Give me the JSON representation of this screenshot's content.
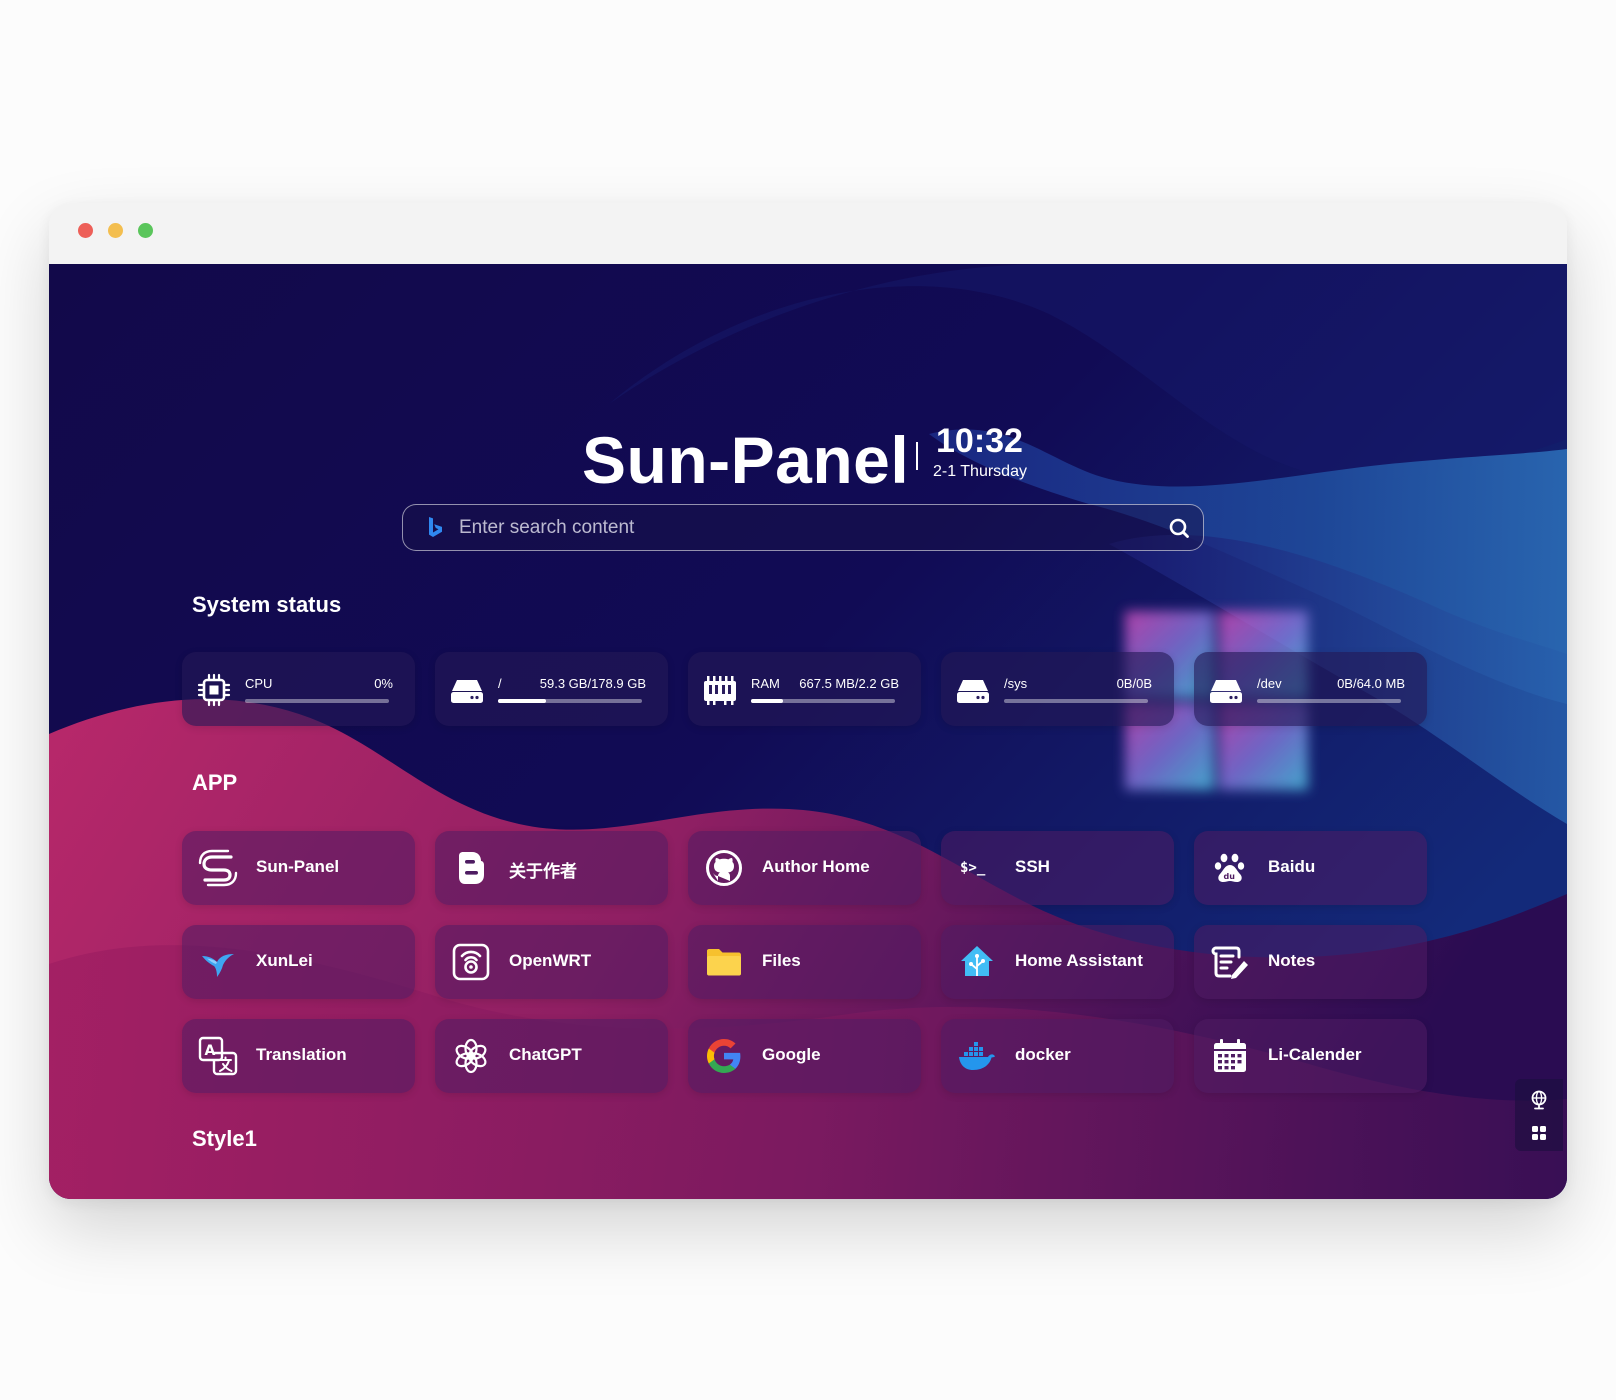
{
  "window": {
    "controls": [
      "close",
      "minimize",
      "maximize"
    ],
    "colors": {
      "close": "#ed5f58",
      "minimize": "#f3be4f",
      "maximize": "#5ac55b"
    }
  },
  "header": {
    "brand": "Sun-Panel",
    "time": "10:32",
    "date": "2-1 Thursday"
  },
  "search": {
    "placeholder": "Enter search content",
    "engine_icon": "bing-icon",
    "button_icon": "search-icon"
  },
  "system_status": {
    "title": "System status",
    "cards": [
      {
        "icon": "cpu-icon",
        "label": "CPU",
        "value": "0%",
        "usage": 0
      },
      {
        "icon": "drive-icon",
        "label": "/",
        "value": "59.3 GB/178.9 GB",
        "usage": 0.33
      },
      {
        "icon": "memory-icon",
        "label": "RAM",
        "value": "667.5 MB/2.2 GB",
        "usage": 0.22
      },
      {
        "icon": "drive-icon",
        "label": "/sys",
        "value": "0B/0B",
        "usage": 0
      },
      {
        "icon": "drive-icon",
        "label": "/dev",
        "value": "0B/64.0 MB",
        "usage": 0
      }
    ]
  },
  "apps": {
    "title": "APP",
    "items": [
      {
        "label": "Sun-Panel",
        "icon": "sun-panel-logo-icon"
      },
      {
        "label": "关于作者",
        "icon": "blogger-icon"
      },
      {
        "label": "Author Home",
        "icon": "github-icon"
      },
      {
        "label": "SSH",
        "icon": "terminal-icon"
      },
      {
        "label": "Baidu",
        "icon": "baidu-paw-icon"
      },
      {
        "label": "XunLei",
        "icon": "xunlei-bird-icon"
      },
      {
        "label": "OpenWRT",
        "icon": "openwrt-icon"
      },
      {
        "label": "Files",
        "icon": "folder-icon"
      },
      {
        "label": "Home Assistant",
        "icon": "home-assistant-icon"
      },
      {
        "label": "Notes",
        "icon": "notes-icon"
      },
      {
        "label": "Translation",
        "icon": "translate-icon"
      },
      {
        "label": "ChatGPT",
        "icon": "openai-icon"
      },
      {
        "label": "Google",
        "icon": "google-icon"
      },
      {
        "label": "docker",
        "icon": "docker-icon"
      },
      {
        "label": "Li-Calender",
        "icon": "calendar-icon"
      }
    ]
  },
  "style1": {
    "title": "Style1"
  },
  "side_tools": [
    "globe-icon",
    "grid-icon"
  ],
  "theme": {
    "background_base": "#110a4a",
    "wave_pink": "#b02466",
    "wave_blue": "#2563ad",
    "card_status": "#241856",
    "card_app": "#4e1c62",
    "text": "#ffffff"
  }
}
